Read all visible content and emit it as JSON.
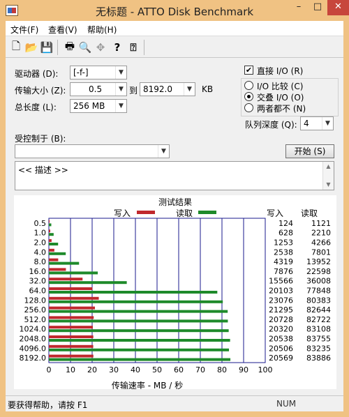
{
  "window": {
    "title": "无标题 - ATTO Disk Benchmark",
    "minimize": "–",
    "maximize": "□",
    "close": "✕"
  },
  "menu": [
    {
      "label": "文件(F)"
    },
    {
      "label": "查看(V)"
    },
    {
      "label": "帮助(H)"
    }
  ],
  "toolbar": {
    "buttons": [
      {
        "name": "new-icon",
        "glyph": "🗋"
      },
      {
        "name": "open-icon",
        "glyph": "📂"
      },
      {
        "name": "save-icon",
        "glyph": "💾"
      },
      {
        "name": "print-icon",
        "glyph": "🖶"
      },
      {
        "name": "print-preview-icon",
        "glyph": "🔍"
      },
      {
        "name": "move-icon",
        "glyph": "✥"
      },
      {
        "name": "help-icon",
        "glyph": "?"
      },
      {
        "name": "context-help-icon",
        "glyph": "⍰"
      }
    ]
  },
  "settings": {
    "drive_label": "驱动器 (D):",
    "drive_value": "[-f-]",
    "transfer_label": "传输大小 (Z):",
    "transfer_from": "0.5",
    "transfer_to_label": "到",
    "transfer_to": "8192.0",
    "transfer_unit": "KB",
    "length_label": "总长度 (L):",
    "length_value": "256 MB",
    "direct_io_label": "直接 I/O (R)",
    "direct_io_checked": true,
    "io_options": [
      {
        "label": "I/O 比较 (C)",
        "selected": false
      },
      {
        "label": "交叠 I/O (O)",
        "selected": true
      },
      {
        "label": "两者都不 (N)",
        "selected": false
      }
    ],
    "queue_label": "队列深度 (Q):",
    "queue_value": "4",
    "controlled_label": "受控制于 (B):",
    "controlled_value": "",
    "start_button": "开始 (S)",
    "description": "<< 描述 >>"
  },
  "chart_data": {
    "type": "bar",
    "title": "测试结果",
    "orientation": "horizontal",
    "categories": [
      "0.5",
      "1.0",
      "2.0",
      "4.0",
      "8.0",
      "16.0",
      "32.0",
      "64.0",
      "128.0",
      "256.0",
      "512.0",
      "1024.0",
      "2048.0",
      "4096.0",
      "8192.0"
    ],
    "series": [
      {
        "name": "写入",
        "color": "#c0282d",
        "values": [
          124,
          628,
          1253,
          2538,
          4319,
          7876,
          15566,
          20103,
          23076,
          21295,
          20728,
          20320,
          20538,
          20506,
          20569
        ]
      },
      {
        "name": "读取",
        "color": "#1e8a2a",
        "values": [
          1121,
          2210,
          4266,
          7801,
          13952,
          22598,
          36008,
          77848,
          80383,
          82644,
          82722,
          83108,
          83755,
          83235,
          83886
        ]
      }
    ],
    "xlabel": "传输速率 - MB / 秒",
    "xlim": [
      0,
      100
    ],
    "xticks": [
      "0",
      "10",
      "20",
      "30",
      "40",
      "50",
      "60",
      "70",
      "80",
      "90",
      "100"
    ],
    "value_unit_scale": 1000,
    "table_headers": [
      "写入",
      "读取"
    ],
    "grid": true
  },
  "status": {
    "help_text": "要获得帮助，请按 F1",
    "indicator": "NUM"
  },
  "colors": {
    "titlebar": "#f0c283",
    "close": "#c7463c",
    "write": "#c0282d",
    "read": "#1e8a2a",
    "grid": "#1a1a8c"
  }
}
